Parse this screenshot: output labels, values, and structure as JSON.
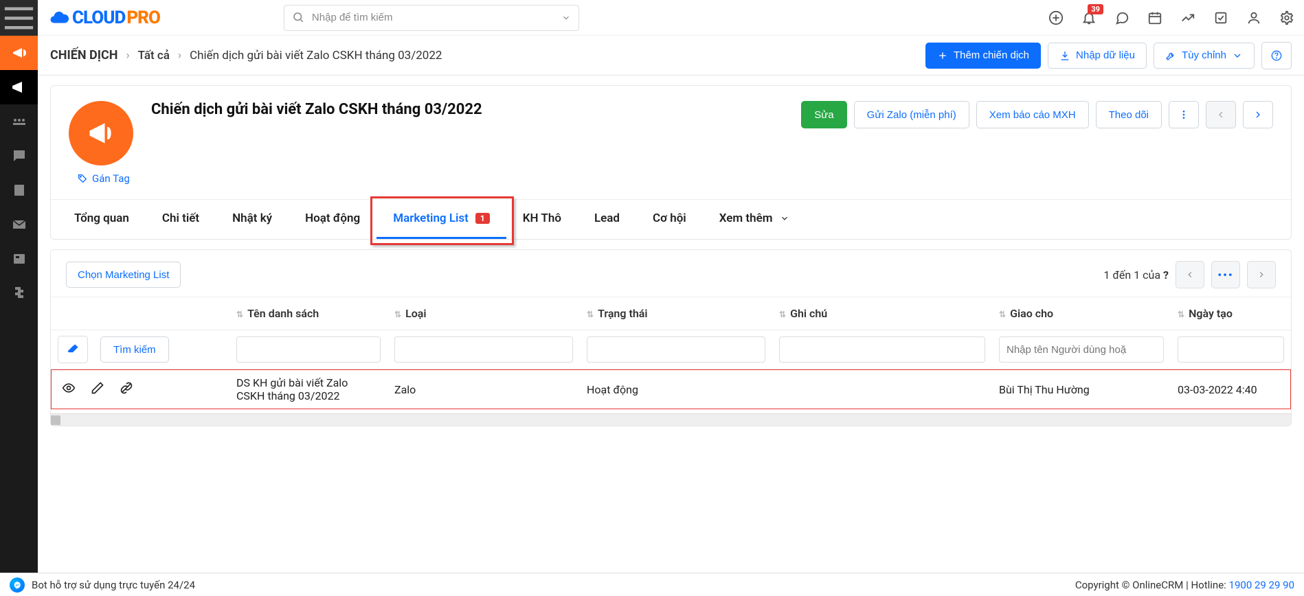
{
  "header": {
    "search_placeholder": "Nhập để tìm kiếm",
    "notif_count": "39"
  },
  "breadcrumb": {
    "module": "CHIẾN DỊCH",
    "filter": "Tất cả",
    "record": "Chiến dịch gửi bài viết Zalo CSKH tháng 03/2022"
  },
  "actions": {
    "add": "Thêm chiến dịch",
    "import": "Nhập dữ liệu",
    "customize": "Tùy chỉnh"
  },
  "record": {
    "title": "Chiến dịch gửi bài viết Zalo CSKH tháng 03/2022",
    "edit": "Sửa",
    "send_zalo": "Gửi Zalo (miễn phí)",
    "report": "Xem báo cáo MXH",
    "follow": "Theo dõi",
    "tag": "Gán Tag"
  },
  "tabs": {
    "overview": "Tổng quan",
    "detail": "Chi tiết",
    "log": "Nhật ký",
    "activity": "Hoạt động",
    "mlist": "Marketing List",
    "mlist_count": "1",
    "raw": "KH Thô",
    "lead": "Lead",
    "opp": "Cơ hội",
    "more": "Xem thêm"
  },
  "list": {
    "choose": "Chọn Marketing List",
    "range": "1 đến 1 của",
    "question": "?",
    "search_btn": "Tìm kiếm",
    "assignee_placeholder": "Nhập tên Người dùng hoặ",
    "cols": {
      "name": "Tên danh sách",
      "type": "Loại",
      "status": "Trạng thái",
      "note": "Ghi chú",
      "assignee": "Giao cho",
      "created": "Ngày tạo"
    },
    "row": {
      "name": "DS KH gửi bài viết Zalo CSKH tháng 03/2022",
      "type": "Zalo",
      "status": "Hoạt động",
      "note": "",
      "assignee": "Bùi Thị Thu Hường",
      "created": "03-03-2022 4:40"
    }
  },
  "footer": {
    "bot": "Bot hỗ trợ sử dụng trực tuyến 24/24",
    "copyright": "Copyright © OnlineCRM",
    "hotline_label": "Hotline:",
    "hotline_num": "1900 29 29 90"
  }
}
